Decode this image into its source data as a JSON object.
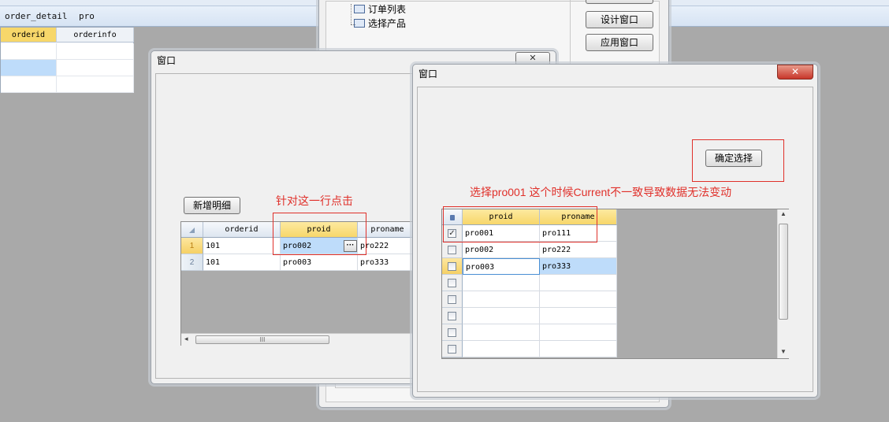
{
  "background": {
    "tabs": [
      "order_detail",
      "pro"
    ],
    "minigrid_headers": [
      "orderid",
      "orderinfo"
    ]
  },
  "designer": {
    "tree_items": [
      "订单列表",
      "选择产品"
    ],
    "buttons": {
      "design": "设计窗口",
      "apply": "应用窗口"
    }
  },
  "window_a": {
    "title": "窗口",
    "add_button": "新增明细",
    "annotation": "针对这一行点击",
    "columns": [
      "orderid",
      "proid",
      "proname"
    ],
    "rows": [
      {
        "num": "1",
        "orderid": "101",
        "proid": "pro002",
        "proname": "pro222"
      },
      {
        "num": "2",
        "orderid": "101",
        "proid": "pro003",
        "proname": "pro333"
      }
    ],
    "ellipsis": "···",
    "hscroll_grip": "III"
  },
  "window_b": {
    "title": "窗口",
    "confirm_button": "确定选择",
    "annotation": "选择pro001  这个时候Current不一致导致数据无法变动",
    "columns": [
      "proid",
      "proname"
    ],
    "rows": [
      {
        "proid": "pro001",
        "proname": "pro111",
        "checked": true
      },
      {
        "proid": "pro002",
        "proname": "pro222",
        "checked": false
      },
      {
        "proid": "pro003",
        "proname": "pro333",
        "checked": false
      }
    ],
    "empty_rows": 5,
    "close_glyph": "✕"
  },
  "colors": {
    "annotation_red": "#e0302a",
    "header_selected": "#f7d76a",
    "row_selected": "#bedcfa",
    "close_button": "#c8362a"
  }
}
